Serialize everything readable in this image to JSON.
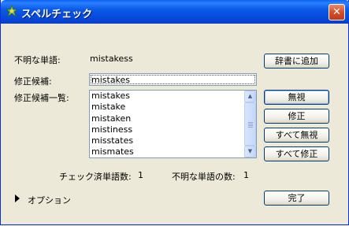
{
  "window": {
    "title": "スペルチェック",
    "close_glyph": "✕"
  },
  "fields": {
    "unknown_word_label": "不明な単語:",
    "unknown_word_value": "mistakess",
    "correction_label": "修正候補:",
    "correction_value": "mistakes",
    "candidates_label": "修正候補一覧:"
  },
  "candidates": [
    "mistakes",
    "mistake",
    "mistaken",
    "mistiness",
    "misstates",
    "mismates"
  ],
  "buttons": {
    "add_to_dictionary": "辞書に追加",
    "ignore": "無視",
    "correct": "修正",
    "ignore_all": "すべて無視",
    "correct_all": "すべて修正",
    "done": "完了"
  },
  "stats": {
    "checked_label": "チェック済単語数:",
    "checked_value": "1",
    "unknown_label": "不明な単語の数:",
    "unknown_value": "1"
  },
  "options": {
    "label": "オプション",
    "icon": "triangle-right-icon"
  }
}
